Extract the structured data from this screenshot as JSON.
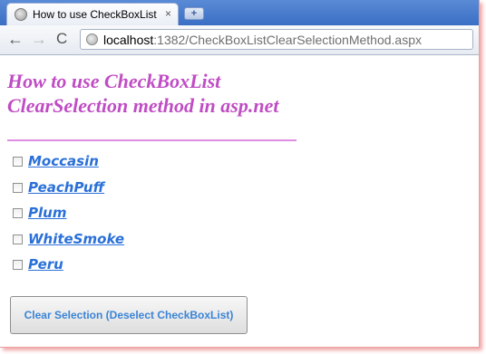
{
  "browser": {
    "tab_title": "How to use CheckBoxList C",
    "tab_close": "×",
    "new_tab": "+",
    "back": "←",
    "forward": "→",
    "reload": "C",
    "url_host": "localhost",
    "url_rest": ":1382/CheckBoxListClearSelectionMethod.aspx"
  },
  "page": {
    "heading_line1": "How to use CheckBoxList",
    "heading_line2": "ClearSelection method in asp.net",
    "checkboxlist": [
      {
        "label": "Moccasin",
        "checked": false
      },
      {
        "label": "PeachPuff",
        "checked": false
      },
      {
        "label": "Plum",
        "checked": false
      },
      {
        "label": "WhiteSmoke",
        "checked": false
      },
      {
        "label": "Peru",
        "checked": false
      }
    ],
    "button_label": "Clear Selection (Deselect CheckBoxList)"
  },
  "colors": {
    "heading": "#c04cc4",
    "rule": "#dd8ee0",
    "item_text": "#2a70d8",
    "button_text": "#3a84d6"
  }
}
